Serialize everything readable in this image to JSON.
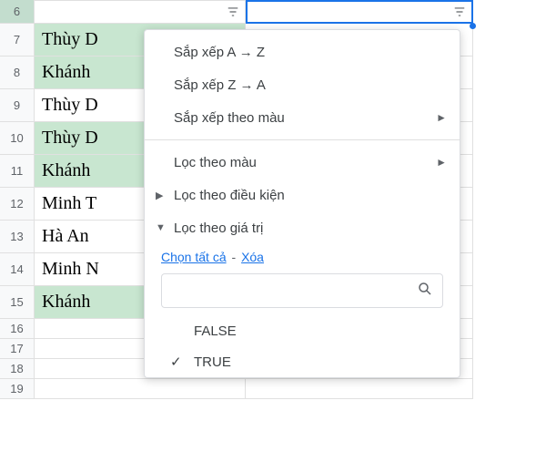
{
  "rows": {
    "r6": {
      "num": "6",
      "name": "",
      "highlight": false
    },
    "r7": {
      "num": "7",
      "name": "Thùy D",
      "highlight": true
    },
    "r8": {
      "num": "8",
      "name": "Khánh ",
      "highlight": true
    },
    "r9": {
      "num": "9",
      "name": "Thùy D",
      "highlight": false
    },
    "r10": {
      "num": "10",
      "name": "Thùy D",
      "highlight": true
    },
    "r11": {
      "num": "11",
      "name": "Khánh ",
      "highlight": true
    },
    "r12": {
      "num": "12",
      "name": "Minh T",
      "highlight": false
    },
    "r13": {
      "num": "13",
      "name": "Hà An",
      "highlight": false
    },
    "r14": {
      "num": "14",
      "name": "Minh N",
      "highlight": false
    },
    "r15": {
      "num": "15",
      "name": "Khánh ",
      "highlight": true
    },
    "r16": {
      "num": "16",
      "name": "",
      "highlight": false
    },
    "r17": {
      "num": "17",
      "name": "",
      "highlight": false
    },
    "r18": {
      "num": "18",
      "name": "",
      "highlight": false
    },
    "r19": {
      "num": "19",
      "name": "",
      "highlight": false
    }
  },
  "menu": {
    "sort_az": "Sắp xếp A → Z",
    "sort_za": "Sắp xếp Z → A",
    "sort_color": "Sắp xếp theo màu",
    "filter_color": "Lọc theo màu",
    "filter_cond": "Lọc theo điều kiện",
    "filter_value": "Lọc theo giá trị",
    "select_all": "Chọn tất cả",
    "clear": "Xóa",
    "search_placeholder": "",
    "values": {
      "v1": {
        "label": "FALSE",
        "checked": false
      },
      "v2": {
        "label": "TRUE",
        "checked": true
      }
    }
  }
}
